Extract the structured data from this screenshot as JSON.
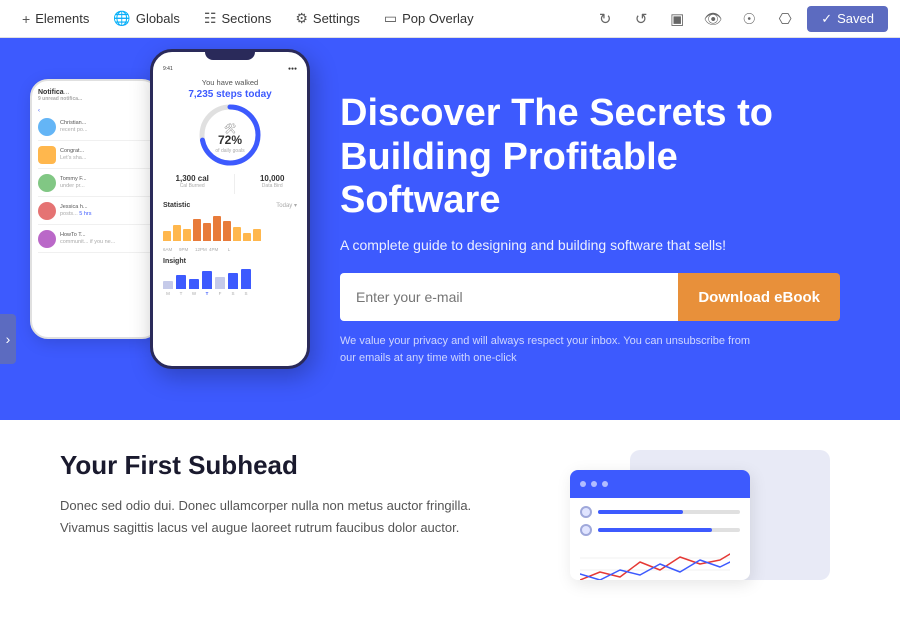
{
  "toolbar": {
    "elements_label": "Elements",
    "globals_label": "Globals",
    "sections_label": "Sections",
    "settings_label": "Settings",
    "pop_overlay_label": "Pop Overlay",
    "saved_label": "Saved"
  },
  "hero": {
    "heading": "Discover The Secrets to Building Profitable Software",
    "subheading": "A complete guide to designing and building software that sells!",
    "email_placeholder": "Enter your e-mail",
    "cta_label": "Download eBook",
    "privacy_text": "We value your privacy and will always respect your inbox.  You can unsubscribe from our emails at any time with one-click"
  },
  "phone_front": {
    "steps_title": "You have walked",
    "steps_count": "7,235 steps today",
    "percent": "72%",
    "percent_sub": "of daily goals",
    "cal_value": "1,300 cal",
    "cal_label": "Cal Burned",
    "data_value": "10,000",
    "data_label": "Data Bird",
    "statistic_label": "Statistic",
    "today_label": "Today ▾",
    "insight_label": "Insight",
    "bar_labels": [
      "6AM",
      "9PM",
      "12PM",
      "4PM",
      "L"
    ]
  },
  "phone_back": {
    "header": "Notifications",
    "sub_header": "9 unread notifica...",
    "notifications": [
      {
        "name": "Christian...",
        "text": "recent po...",
        "time": "~"
      },
      {
        "name": "Congrat...",
        "text": "Let's sha...",
        "time": "~"
      },
      {
        "name": "Tommy F...",
        "text": "under pr...",
        "time": "~"
      },
      {
        "name": "Jessica h...",
        "text": "posts...",
        "time": "5 hrs"
      },
      {
        "name": "HowTo T...",
        "text": "communit... if you ne...",
        "time": "~"
      }
    ]
  },
  "bottom": {
    "subhead_title": "Your First Subhead",
    "body_text": "Donec sed odio dui. Donec ullamcorper nulla non metus auctor fringilla. Vivamus sagittis lacus vel augue laoreet rutrum faucibus dolor auctor."
  },
  "colors": {
    "hero_bg": "#3d5afe",
    "cta_bg": "#e8903a",
    "saved_bg": "#5c6bc0"
  }
}
